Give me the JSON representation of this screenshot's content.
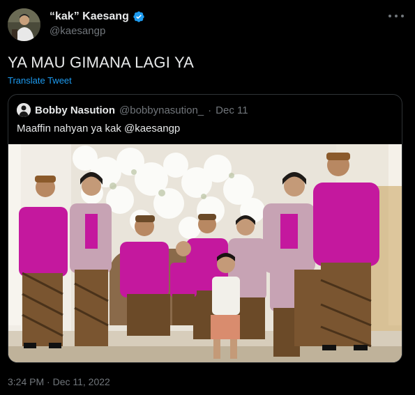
{
  "author": {
    "display_name": "“kak” Kaesang",
    "handle": "@kaesangp",
    "verified": true,
    "avatar_icon": "profile-avatar"
  },
  "more_icon": "ellipsis-icon",
  "tweet": {
    "text": "YA MAU GIMANA LAGI YA",
    "translate_label": "Translate Tweet",
    "timestamp": "3:24 PM · Dec 11, 2022"
  },
  "quoted": {
    "display_name": "Bobby Nasution",
    "handle": "@bobbynasution_",
    "separator": "·",
    "date": "Dec 11",
    "text": "Maaffin nahyan ya kak @kaesangp",
    "photo_alt": "family-photo"
  },
  "colors": {
    "background": "#000000",
    "text_primary": "#e7e9ea",
    "text_secondary": "#71767b",
    "link": "#1d9bf0",
    "border": "#2f3336",
    "verified": "#1d9bf0",
    "magenta_attire": "#c4189e"
  }
}
